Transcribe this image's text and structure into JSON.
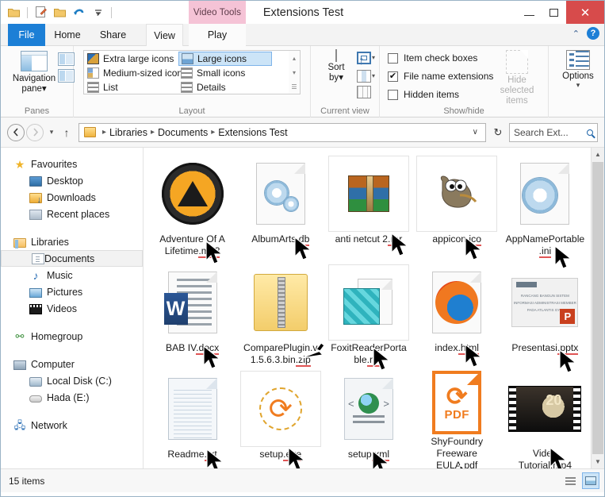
{
  "window": {
    "title": "Extensions Test",
    "contextual_tab": "Video Tools",
    "minimize": "—",
    "maximize": "□",
    "close": "✕"
  },
  "quick_access": [
    {
      "name": "new-folder-icon",
      "glyph": "📁"
    },
    {
      "name": "properties-icon",
      "glyph": "📄"
    },
    {
      "name": "open-folder-icon",
      "glyph": "📂"
    },
    {
      "name": "undo-icon",
      "glyph": "↶"
    },
    {
      "name": "customize-caret-icon",
      "glyph": "▾"
    }
  ],
  "tabs": [
    {
      "label": "File",
      "active": false
    },
    {
      "label": "Home",
      "active": false
    },
    {
      "label": "Share",
      "active": false
    },
    {
      "label": "View",
      "active": true
    },
    {
      "label": "Play",
      "active": false
    }
  ],
  "ribbon": {
    "collapse_caret": "⌃",
    "help_label": "?",
    "groups": [
      {
        "label": "Panes",
        "navigation_pane": "Navigation\npane",
        "navigation_pane_line1": "Navigation",
        "navigation_pane_line2": "pane",
        "dropdown_caret": "▾"
      },
      {
        "label": "Layout",
        "items": [
          {
            "label": "Extra large icons",
            "selected": false
          },
          {
            "label": "Large icons",
            "selected": true
          },
          {
            "label": "Medium-sized icons",
            "selected": false
          },
          {
            "label": "Small icons",
            "selected": false
          },
          {
            "label": "List",
            "selected": false
          },
          {
            "label": "Details",
            "selected": false
          }
        ],
        "scroll_up": "▴",
        "scroll_down": "▾",
        "scroll_more": "☰"
      },
      {
        "label": "Current view",
        "sort_by_line1": "Sort",
        "sort_by_line2": "by",
        "sort_caret": "▾"
      },
      {
        "label": "Show/hide",
        "checkboxes": [
          {
            "label": "Item check boxes",
            "checked": false
          },
          {
            "label": "File name extensions",
            "checked": true
          },
          {
            "label": "Hidden items",
            "checked": false
          }
        ],
        "hide_selected_line1": "Hide selected",
        "hide_selected_line2": "items"
      },
      {
        "label": "",
        "options_label": "Options",
        "options_caret": "▾"
      }
    ]
  },
  "address_bar": {
    "back": "←",
    "forward": "→",
    "recent_caret": "▾",
    "up": "↑",
    "breadcrumbs": [
      "Libraries",
      "Documents",
      "Extensions Test"
    ],
    "separator": "▸",
    "dropdown_caret": "∨",
    "refresh": "↻",
    "search_placeholder": "Search Ext..."
  },
  "sidebar": {
    "groups": [
      {
        "header": {
          "label": "Favourites",
          "icon": "star-icon"
        },
        "items": [
          {
            "label": "Desktop",
            "icon": "desktop-icon"
          },
          {
            "label": "Downloads",
            "icon": "downloads-icon"
          },
          {
            "label": "Recent places",
            "icon": "recent-places-icon"
          }
        ]
      },
      {
        "header": {
          "label": "Libraries",
          "icon": "libraries-icon"
        },
        "items": [
          {
            "label": "Documents",
            "icon": "documents-icon",
            "selected": true
          },
          {
            "label": "Music",
            "icon": "music-icon"
          },
          {
            "label": "Pictures",
            "icon": "pictures-icon"
          },
          {
            "label": "Videos",
            "icon": "videos-icon"
          }
        ]
      },
      {
        "header": {
          "label": "Homegroup",
          "icon": "homegroup-icon"
        },
        "items": []
      },
      {
        "header": {
          "label": "Computer",
          "icon": "computer-icon"
        },
        "items": [
          {
            "label": "Local Disk (C:)",
            "icon": "local-disk-icon"
          },
          {
            "label": "Hada (E:)",
            "icon": "removable-drive-icon"
          }
        ]
      },
      {
        "header": {
          "label": "Network",
          "icon": "network-icon"
        },
        "items": []
      }
    ]
  },
  "files": [
    {
      "name": "Adventure Of A Lifetime.mp3",
      "base": "Adventure Of A Lifetime",
      "ext": ".mp3",
      "icon": "aimp-audio-icon",
      "framed": false
    },
    {
      "name": "AlbumArts.db",
      "base": "AlbumArts",
      "ext": ".db",
      "icon": "generic-gear-file-icon",
      "framed": false
    },
    {
      "name": "anti netcut 2.rar",
      "base": "anti netcut 2",
      "ext": ".rar",
      "icon": "winrar-archive-icon",
      "framed": true
    },
    {
      "name": "appicon.ico",
      "base": "appicon",
      "ext": ".ico",
      "icon": "gimp-wilber-icon",
      "framed": true
    },
    {
      "name": "AppNamePortable.ini",
      "base": "AppNamePortable",
      "ext": ".ini",
      "icon": "generic-gear-file-icon",
      "framed": false
    },
    {
      "name": "BAB IV.docx",
      "base": "BAB IV",
      "ext": ".docx",
      "icon": "word-document-icon",
      "framed": false
    },
    {
      "name": "ComparePlugin.v1.5.6.3.bin.zip",
      "base": "ComparePlugin.v1.5.6.3.bin",
      "ext": ".zip",
      "icon": "zip-folder-icon",
      "framed": false
    },
    {
      "name": "FoxitReaderPortable.reg",
      "base": "FoxitReaderPortable",
      "ext": ".reg",
      "icon": "registry-file-icon",
      "framed": true
    },
    {
      "name": "index.html",
      "base": "index",
      "ext": ".html",
      "icon": "firefox-html-icon",
      "framed": false
    },
    {
      "name": "Presentasi.pptx",
      "base": "Presentasi",
      "ext": ".pptx",
      "icon": "powerpoint-thumbnail-icon",
      "framed": false,
      "thumb_lines": [
        "RANCANG BANGUN SISTEM",
        "INFORMASI ADMINISTRASI MEMBER",
        "PADA ATLANTIS GYM"
      ]
    },
    {
      "name": "Readme.txt",
      "base": "Readme",
      "ext": ".txt",
      "icon": "text-file-icon",
      "framed": false
    },
    {
      "name": "setup.exe",
      "base": "setup",
      "ext": ".exe",
      "icon": "installer-exe-icon",
      "framed": true
    },
    {
      "name": "setup.xml",
      "base": "setup",
      "ext": ".xml",
      "icon": "xml-file-icon",
      "framed": false
    },
    {
      "name": "ShyFoundry Freeware EULA.pdf",
      "base": "ShyFoundry Freeware EULA",
      "ext": ".pdf",
      "icon": "pdf-file-icon",
      "framed": false,
      "pdf_label": "PDF"
    },
    {
      "name": "Video Tutorial.mp4",
      "base": "Video Tutorial",
      "ext": ".mp4",
      "icon": "video-thumbnail-icon",
      "framed": false,
      "thumb_text": "20"
    }
  ],
  "status_bar": {
    "item_count": "15 items",
    "view_details_icon": "details-view-icon",
    "view_large_icon": "large-icons-view-icon"
  },
  "colors": {
    "accent_blue": "#1c7fd6",
    "close_red": "#d74b4b",
    "contextual_pink": "#f5c3d6",
    "selection_blue": "#cce4f7",
    "underline_red": "#e05555"
  }
}
